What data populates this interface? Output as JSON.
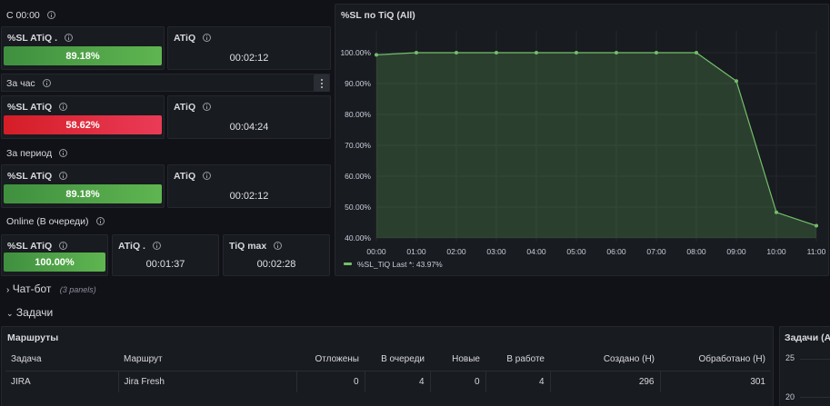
{
  "row_since": {
    "title": "С 00:00"
  },
  "row_hour": {
    "title": "За час"
  },
  "row_period": {
    "title": "За период"
  },
  "row_online": {
    "title": "Online (В очереди)"
  },
  "stat_since_sl": {
    "title": "%SL ATiQ .",
    "value": "89.18%",
    "level_percent": 89.18
  },
  "stat_since_atiq": {
    "title": "ATiQ",
    "value": "00:02:12"
  },
  "stat_hour_sl": {
    "title": "%SL ATiQ",
    "value": "58.62%",
    "level_percent": 58.62
  },
  "stat_hour_atiq": {
    "title": "ATiQ",
    "value": "00:04:24"
  },
  "stat_period_sl": {
    "title": "%SL ATiQ",
    "value": "89.18%",
    "level_percent": 89.18
  },
  "stat_period_atiq": {
    "title": "ATiQ",
    "value": "00:02:12"
  },
  "stat_online_sl": {
    "title": "%SL ATiQ",
    "value": "100.00%",
    "level_percent": 100
  },
  "stat_online_atiq": {
    "title": "ATiQ .",
    "value": "00:01:37"
  },
  "stat_online_tiqmax": {
    "title": "TiQ max",
    "value": "00:02:28"
  },
  "menu_icon": "kebab-menu-icon",
  "colors": {
    "background": "#111217",
    "panel": "#181b1f",
    "green": "#5fb550",
    "red": "#e02f44",
    "series": "#73bf69"
  },
  "chart_panel": {
    "title": "%SL по TiQ (All)"
  },
  "chart_data": {
    "type": "area",
    "title": "%SL по TiQ (All)",
    "x": [
      "00:00",
      "01:00",
      "02:00",
      "03:00",
      "04:00",
      "05:00",
      "06:00",
      "07:00",
      "08:00",
      "09:00",
      "10:00",
      "11:00"
    ],
    "x_ticks": [
      "00:00",
      "01:00",
      "02:00",
      "03:00",
      "04:00",
      "05:00",
      "06:00",
      "07:00",
      "08:00",
      "09:00",
      "10:00",
      "11:00"
    ],
    "series": [
      {
        "name": "%SL_TiQ",
        "values": [
          99.3,
          100,
          100,
          100,
          100,
          100,
          100,
          100,
          100,
          90.8,
          48.3,
          43.97
        ]
      }
    ],
    "y_ticks": [
      "100.00%",
      "90.00%",
      "80.00%",
      "70.00%",
      "60.00%",
      "50.00%",
      "40.00%"
    ],
    "ylim": [
      40,
      100
    ],
    "legend": {
      "label": "%SL_TiQ",
      "stat": "Last *: 43.97%",
      "placement": "bottom-left"
    },
    "grid": true
  },
  "row_chatbot": {
    "title": "Чат-бот",
    "subtitle": "(3 panels)"
  },
  "row_tasks": {
    "title": "Задачи"
  },
  "routes_table": {
    "title": "Маршруты",
    "columns": [
      "Задача",
      "Маршрут",
      "Отложены",
      "В очереди",
      "Новые",
      "В работе",
      "Создано (Н)",
      "Обработано (Н)"
    ],
    "rows": [
      [
        "JIRA",
        "Jira Fresh",
        "0",
        "4",
        "0",
        "4",
        "296",
        "301"
      ]
    ]
  },
  "tasks_chart": {
    "title": "Задачи (All)",
    "y_ticks": [
      "25",
      "20"
    ]
  }
}
